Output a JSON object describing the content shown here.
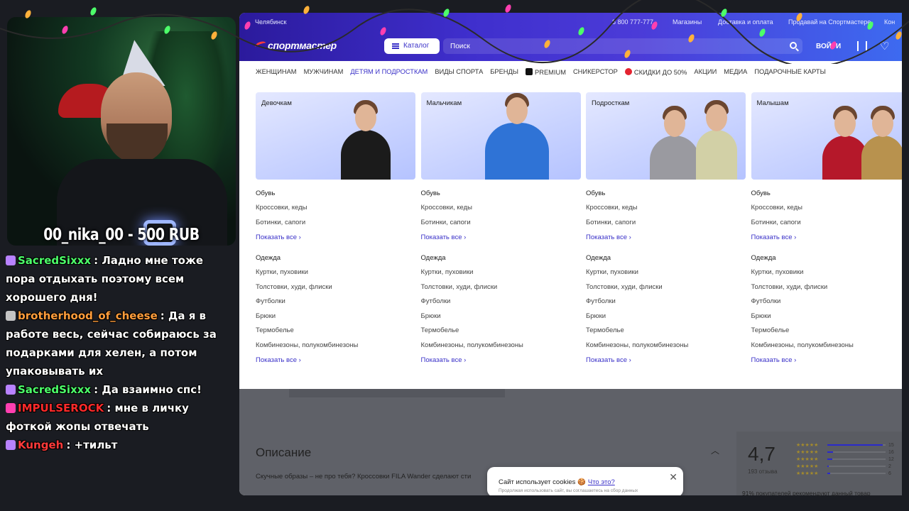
{
  "stream": {
    "donation_text": "00_nika_00 - 500 RUB"
  },
  "chat": [
    {
      "user": "SacredSixxx",
      "user_color": "#4dff6a",
      "badge_color": "#b882ff",
      "text": "Ладно мне тоже пора отдыхать поэтому всем хорошего дня!"
    },
    {
      "user": "brotherhood_of_cheese",
      "user_color": "#ff9d3b",
      "badge_color": "#c4c4c4",
      "text": "Да я в работе весь, сейчас собираюсь за подарками для хелен, а потом упаковывать их"
    },
    {
      "user": "SacredSixxx",
      "user_color": "#4dff6a",
      "badge_color": "#b882ff",
      "text": "Да взаимно спс!"
    },
    {
      "user": "IMPULSEROCK",
      "user_color": "#ff2a2a",
      "badge_color": "#ff3fb0",
      "text": "мне в личку фоткой жопы отвечать"
    },
    {
      "user": "Kungeh",
      "user_color": "#ff3a3a",
      "badge_color": "#b882ff",
      "text": "+тильт"
    }
  ],
  "header": {
    "city": "Челябинск",
    "phone": "8 800 777-777",
    "links": [
      "Магазины",
      "Доставка и оплата",
      "Продавай на Спортмастере",
      "Кон"
    ],
    "logo": "спортмастер",
    "catalog_label": "Каталог",
    "search_placeholder": "Поиск",
    "login_label": "ВОЙТИ"
  },
  "nav": {
    "items": [
      "ЖЕНЩИНАМ",
      "МУЖЧИНАМ",
      "ДЕТЯМ И ПОДРОСТКАМ",
      "ВИДЫ СПОРТА",
      "БРЕНДЫ",
      "PREMIUM",
      "СНИКЕРСТОР",
      "СКИДКИ ДО 50%",
      "АКЦИИ",
      "МЕДИА",
      "ПОДАРОЧНЫЕ КАРТЫ"
    ]
  },
  "columns": [
    {
      "title": "Девочкам",
      "shoes_title": "Обувь",
      "shoes": [
        "Кроссовки, кеды",
        "Ботинки, сапоги"
      ],
      "show_all_1": "Показать все",
      "clothes_title": "Одежда",
      "clothes": [
        "Куртки, пуховики",
        "Толстовки, худи, флиски",
        "Футболки",
        "Брюки",
        "Термобелье",
        "Комбинезоны, полукомбинезоны"
      ],
      "show_all_2": "Показать все"
    },
    {
      "title": "Мальчикам",
      "shoes_title": "Обувь",
      "shoes": [
        "Кроссовки, кеды",
        "Ботинки, сапоги"
      ],
      "show_all_1": "Показать все",
      "clothes_title": "Одежда",
      "clothes": [
        "Куртки, пуховики",
        "Толстовки, худи, флиски",
        "Футболки",
        "Брюки",
        "Термобелье",
        "Комбинезоны, полукомбинезоны"
      ],
      "show_all_2": "Показать все"
    },
    {
      "title": "Подросткам",
      "shoes_title": "Обувь",
      "shoes": [
        "Кроссовки, кеды",
        "Ботинки, сапоги"
      ],
      "show_all_1": "Показать все",
      "clothes_title": "Одежда",
      "clothes": [
        "Куртки, пуховики",
        "Толстовки, худи, флиски",
        "Футболки",
        "Брюки",
        "Термобелье",
        "Комбинезоны, полукомбинезоны"
      ],
      "show_all_2": "Показать все"
    },
    {
      "title": "Малышам",
      "shoes_title": "Обувь",
      "shoes": [
        "Кроссовки, кеды",
        "Ботинки, сапоги"
      ],
      "show_all_1": "Показать все",
      "clothes_title": "Одежда",
      "clothes": [
        "Куртки, пуховики",
        "Толстовки, худи, флиски",
        "Футболки",
        "Брюки",
        "Термобелье",
        "Комбинезоны, полукомбинезоны"
      ],
      "show_all_2": "Показать все"
    }
  ],
  "product": {
    "description_title": "Описание",
    "description_text": "Скучные образы – не про тебя? Кроссовки FILA Wander сделают сти",
    "rating_score": "4,7",
    "rating_count": "193 отзыва",
    "rating_bars": [
      {
        "label": "15",
        "fill": 0.95
      },
      {
        "label": "16",
        "fill": 0.1
      },
      {
        "label": "12",
        "fill": 0.08
      },
      {
        "label": "2",
        "fill": 0.03
      },
      {
        "label": "6",
        "fill": 0.05
      }
    ],
    "recommend_text": "91% покупателей рекомендуют данный товар"
  },
  "cookie": {
    "text": "Сайт использует cookies 🍪",
    "link": "Что это?",
    "sub": "Продолжая использовать сайт, вы соглашаетесь на сбор данных"
  },
  "colors": {
    "brand": "#3a31c8",
    "header_gradient_start": "#2b1a9c",
    "sale": "#e42330"
  }
}
